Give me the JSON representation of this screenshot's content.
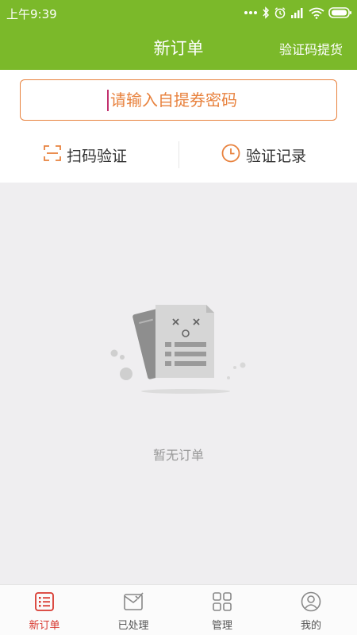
{
  "status_bar": {
    "time": "上午9:39"
  },
  "header": {
    "title": "新订单",
    "action_label": "验证码提货"
  },
  "verify": {
    "input_placeholder": "请输入自提券密码",
    "scan_label": "扫码验证",
    "history_label": "验证记录"
  },
  "empty_state": {
    "text": "暂无订单"
  },
  "tabbar": {
    "items": [
      {
        "label": "新订单",
        "icon": "order-list-icon",
        "active": true
      },
      {
        "label": "已处理",
        "icon": "processed-icon",
        "active": false
      },
      {
        "label": "管理",
        "icon": "grid-icon",
        "active": false
      },
      {
        "label": "我的",
        "icon": "user-icon",
        "active": false
      }
    ]
  },
  "colors": {
    "brand_green": "#7bb92a",
    "accent_orange": "#e8823e",
    "active_tab_red": "#d8382f",
    "background": "#efeef0"
  }
}
